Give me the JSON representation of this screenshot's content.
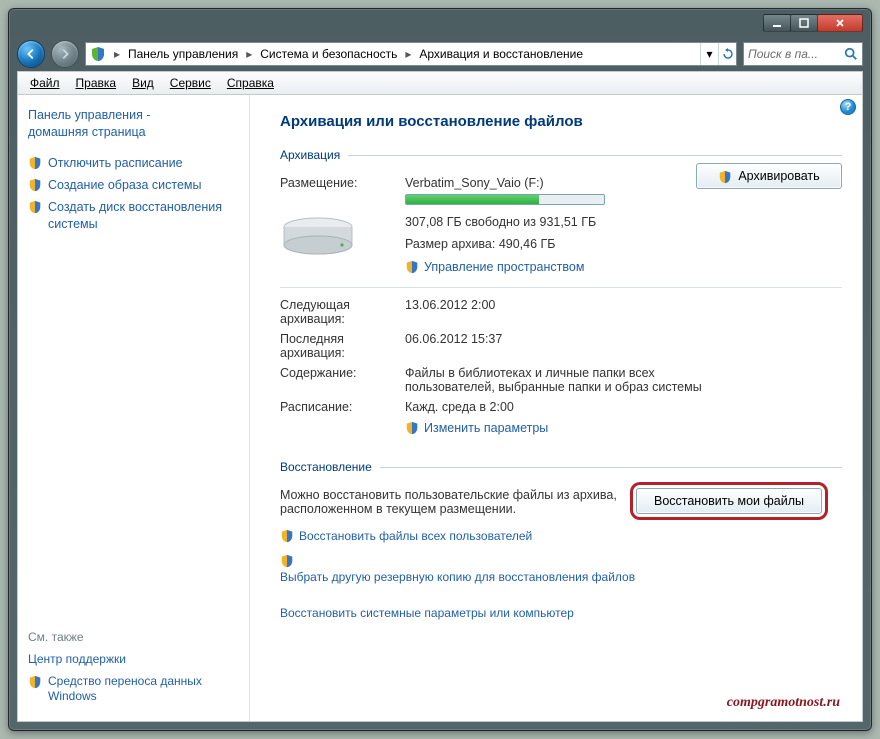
{
  "title_buttons": {
    "min_aria": "Свернуть",
    "max_aria": "Максимизировать",
    "close_aria": "Закрыть"
  },
  "breadcrumbs": {
    "seg0": "Панель управления",
    "seg1": "Система и безопасность",
    "seg2": "Архивация и восстановление"
  },
  "search": {
    "placeholder": "Поиск в па..."
  },
  "menu": {
    "file": "Файл",
    "edit": "Правка",
    "view": "Вид",
    "tools": "Сервис",
    "help": "Справка"
  },
  "sidebar": {
    "home1": "Панель управления -",
    "home2": "домашняя страница",
    "items": [
      {
        "label": "Отключить расписание"
      },
      {
        "label": "Создание образа системы"
      },
      {
        "label": "Создать диск восстановления системы"
      }
    ],
    "see_also": "См. также",
    "support": "Центр поддержки",
    "migration": "Средство переноса данных Windows"
  },
  "main": {
    "title": "Архивация или восстановление файлов",
    "s_archive": "Архивация",
    "s_restore": "Восстановление",
    "archive_btn": "Архивировать",
    "location_label": "Размещение:",
    "location_value": "Verbatim_Sony_Vaio (F:)",
    "free_space": "307,08 ГБ свободно из 931,51 ГБ",
    "archive_size": "Размер архива: 490,46 ГБ",
    "manage_link": "Управление пространством",
    "next_label": "Следующая архивация:",
    "next_value": "13.06.2012 2:00",
    "last_label": "Последняя архивация:",
    "last_value": "06.06.2012 15:37",
    "content_label": "Содержание:",
    "content_value": "Файлы в библиотеках и личные папки всех пользователей, выбранные папки и образ системы",
    "sched_label": "Расписание:",
    "sched_value": "Кажд. среда в 2:00",
    "change_link": "Изменить параметры",
    "restore_text": "Можно восстановить пользовательские файлы из архива, расположенном в текущем размещении.",
    "restore_all": "Восстановить файлы всех пользователей",
    "select_other": "Выбрать другую резервную копию для восстановления файлов",
    "restore_sys": "Восстановить системные параметры или компьютер",
    "restore_btn": "Восстановить мои файлы"
  },
  "watermark": "compgramotnost.ru"
}
